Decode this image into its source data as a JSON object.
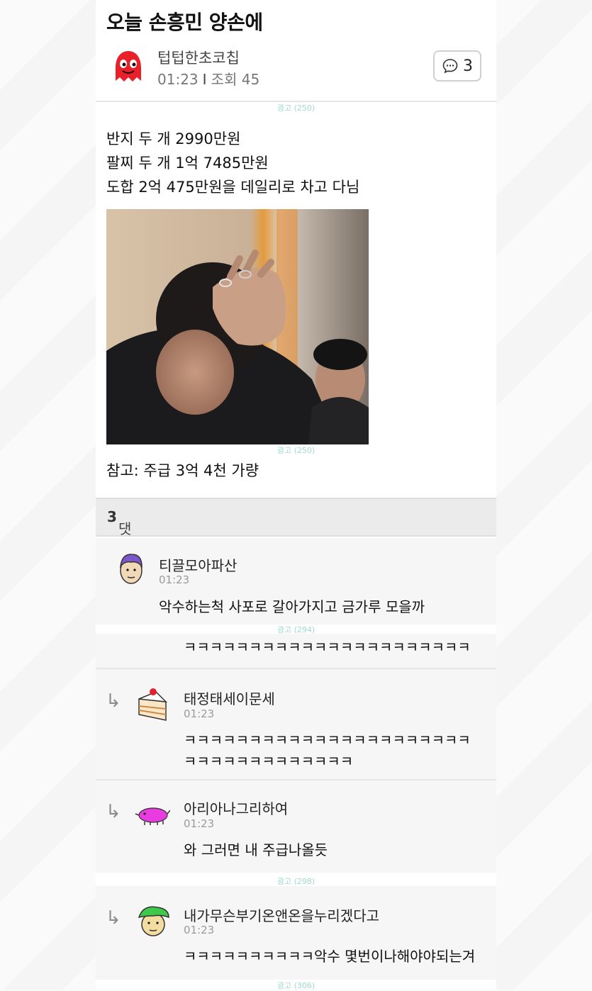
{
  "post": {
    "title": "오늘 손흥민 양손에",
    "author": "텁텁한초코칩",
    "time": "01:23",
    "views_label": "조회",
    "views": "45",
    "comment_count": "3",
    "body_lines": [
      "반지 두 개 2990만원",
      "팔찌 두 개 1억 7485만원",
      "도합 2억 475만원을 데일리로 차고 다님"
    ],
    "note": "참고: 주급 3억 4천 가량"
  },
  "ad_labels": [
    "광고 (250)",
    "광고 (250)",
    "광고 (294)",
    "광고 (298)",
    "광고 (306)"
  ],
  "comments_header": {
    "label": "댓글",
    "count": "3"
  },
  "comments": [
    {
      "nick": "티끌모아파산",
      "time": "01:23",
      "text": "악수하는척 사포로 갈아가지고 금가루 모을까",
      "avatar": "purple-hair-avatar-icon"
    },
    {
      "nick": "",
      "time": "",
      "text": "ㅋㅋㅋㅋㅋㅋㅋㅋㅋㅋㅋㅋㅋㅋㅋㅋㅋㅋㅋㅋㅋㅋ",
      "avatar": ""
    },
    {
      "nick": "태정태세이문세",
      "time": "01:23",
      "text_lines": [
        "ㅋㅋㅋㅋㅋㅋㅋㅋㅋㅋㅋㅋㅋㅋㅋㅋㅋㅋㅋㅋㅋㅋ",
        "ㅋㅋㅋㅋㅋㅋㅋㅋㅋㅋㅋㅋㅋ"
      ],
      "avatar": "cake-icon"
    },
    {
      "nick": "아리아나그리하여",
      "time": "01:23",
      "text": "와 그러면 내 주급나올듯",
      "avatar": "pink-pig-icon"
    },
    {
      "nick": "내가무슨부기온앤온을누리겠다고",
      "time": "01:23",
      "text": "ㅋㅋㅋㅋㅋㅋㅋㅋㅋㅋ악수 몇번이나해야야되는겨",
      "avatar": "green-hair-avatar-icon"
    }
  ],
  "colors": {
    "accent_ghost": "#e8202a",
    "background": "#ffffff",
    "page": "#fafafa"
  }
}
